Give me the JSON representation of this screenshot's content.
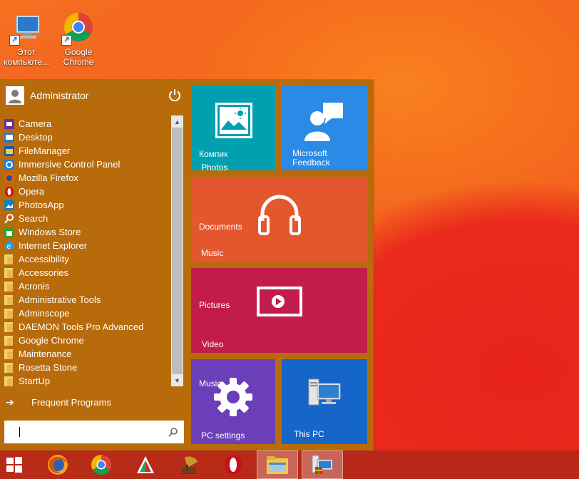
{
  "desktop": {
    "icons": [
      {
        "label": "Этот компьюте...",
        "icon": "this-pc-icon"
      },
      {
        "label": "Google Chrome",
        "icon": "chrome-icon"
      }
    ]
  },
  "start_menu": {
    "user": {
      "name": "Administrator",
      "icon": "user-icon"
    },
    "power_icon": "power-icon",
    "programs": [
      {
        "label": "Camera",
        "icon": "camera-app-icon"
      },
      {
        "label": "Desktop",
        "icon": "desktop-app-icon"
      },
      {
        "label": "FileManager",
        "icon": "file-manager-icon"
      },
      {
        "label": "Immersive Control Panel",
        "icon": "control-panel-icon"
      },
      {
        "label": "Mozilla Firefox",
        "icon": "firefox-icon"
      },
      {
        "label": "Opera",
        "icon": "opera-icon"
      },
      {
        "label": "PhotosApp",
        "icon": "photos-app-icon"
      },
      {
        "label": "Search",
        "icon": "search-app-icon"
      },
      {
        "label": "Windows Store",
        "icon": "store-icon"
      },
      {
        "label": "Internet Explorer",
        "icon": "ie-icon"
      },
      {
        "label": "Accessibility",
        "icon": "folder-icon"
      },
      {
        "label": "Accessories",
        "icon": "folder-icon"
      },
      {
        "label": "Acronis",
        "icon": "folder-icon"
      },
      {
        "label": "Administrative Tools",
        "icon": "folder-icon"
      },
      {
        "label": "Adminscope",
        "icon": "folder-icon"
      },
      {
        "label": "DAEMON Tools Pro Advanced",
        "icon": "folder-icon"
      },
      {
        "label": "Google Chrome",
        "icon": "folder-icon"
      },
      {
        "label": "Maintenance",
        "icon": "folder-icon"
      },
      {
        "label": "Rosetta Stone",
        "icon": "folder-icon"
      },
      {
        "label": "StartUp",
        "icon": "folder-icon"
      }
    ],
    "frequent_label": "Frequent Programs",
    "search": {
      "value": "",
      "placeholder": ""
    },
    "tiles": {
      "photos": {
        "label": "Компик",
        "name": "Photos",
        "color": "#00a0b0"
      },
      "feedback": {
        "label": "Microsoft Feedback",
        "color": "#2b8ae6"
      },
      "music": {
        "label": "Documents",
        "name": "Music",
        "color": "#e4572e"
      },
      "video": {
        "label": "Pictures",
        "name": "Video",
        "color": "#c21d4a"
      },
      "settings": {
        "label": "Music",
        "name": "PC settings",
        "color": "#6b3fb8"
      },
      "thispc": {
        "name": "This PC",
        "color": "#1665c9"
      }
    }
  },
  "taskbar": {
    "items": [
      {
        "icon": "windows-start-icon"
      },
      {
        "icon": "firefox-icon"
      },
      {
        "icon": "chrome-icon"
      },
      {
        "icon": "app-red-green-icon"
      },
      {
        "icon": "gramophone-icon"
      },
      {
        "icon": "opera-icon"
      },
      {
        "icon": "file-explorer-icon",
        "active": true
      },
      {
        "icon": "this-pc-icon",
        "active": true
      }
    ]
  },
  "colors": {
    "start_menu_bg": "#b86b0b",
    "taskbar_bg": "#b22818"
  }
}
